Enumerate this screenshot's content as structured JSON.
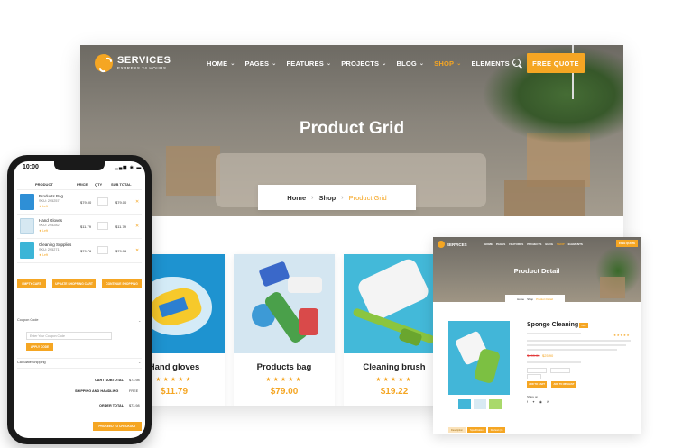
{
  "brand": {
    "name": "SERVICES",
    "tagline": "EXPRESS 24 HOURS",
    "accent": "#f5a623"
  },
  "nav": {
    "items": [
      {
        "label": "HOME"
      },
      {
        "label": "PAGES"
      },
      {
        "label": "FEATURES"
      },
      {
        "label": "PROJECTS"
      },
      {
        "label": "BLOG"
      },
      {
        "label": "SHOP",
        "active": true
      },
      {
        "label": "ELEMENTS"
      }
    ],
    "quote_button": "FREE QUOTE"
  },
  "hero": {
    "title": "Product Grid"
  },
  "breadcrumb": {
    "home": "Home",
    "shop": "Shop",
    "current": "Product Grid",
    "separator": "›"
  },
  "products": [
    {
      "name": "Hand gloves",
      "price": "$11.79",
      "rating": "★★★★★"
    },
    {
      "name": "Products bag",
      "price": "$79.00",
      "rating": "★★★★★"
    },
    {
      "name": "Cleaning brush",
      "price": "$19.22",
      "rating": "★★★★★"
    }
  ],
  "phone": {
    "time": "10:00",
    "status": "▂▄▆ ◉ ▬",
    "cart": {
      "headers": [
        "PRODUCT",
        "PRICE",
        "QTY",
        "SUB TOTAL"
      ],
      "rows": [
        {
          "name": "Products Bag",
          "sku": "SKU: 295257",
          "stock": "★ Left",
          "price": "$79.00",
          "subtotal": "$79.00"
        },
        {
          "name": "Hand Gloves",
          "sku": "SKU: 295282",
          "stock": "★ Left",
          "price": "$11.79",
          "subtotal": "$11.79"
        },
        {
          "name": "Cleaning Supplies",
          "sku": "SKU: 295271",
          "stock": "★ Left",
          "price": "$79.76",
          "subtotal": "$79.76"
        }
      ],
      "remove": "✕",
      "buttons": [
        "EMPTY CART",
        "UPDATE SHOPPING CART",
        "CONTINUE SHOPPING"
      ],
      "coupon_label": "Coupon Code",
      "coupon_placeholder": "Enter Your Coupon Code",
      "apply_button": "APPLY CODE",
      "shipping_label": "Calculate Shipping",
      "totals": [
        {
          "label": "CART SUBTOTAL",
          "value": "$73.98"
        },
        {
          "label": "SHIPPING AND HANDLING",
          "value": "FREE"
        },
        {
          "label": "ORDER TOTAL",
          "value": "$73.98"
        }
      ],
      "checkout_button": "PROCEED TO CHECKOUT"
    }
  },
  "detail": {
    "brand": "SERVICES",
    "menu": [
      "HOME",
      "PAGES",
      "FEATURES",
      "PROJECTS",
      "BLOG",
      "SHOP",
      "ELEMENTS"
    ],
    "quote_button": "FREE QUOTE",
    "title": "Product Detail",
    "crumbs": [
      "Home",
      "Shop",
      "Product Detail"
    ],
    "product_name": "Sponge Cleaning",
    "badge": "New",
    "rating": "★★★★★",
    "old_price": "$499.00",
    "new_price": "$25.90",
    "add_to_cart": "ADD TO CART",
    "wishlist": "ADD TO WISHLIST",
    "share_label": "Share on",
    "share_icons": "f ✦ ◉ ✉",
    "tabs": [
      "Description",
      "Specification",
      "Reviews (3)"
    ]
  }
}
